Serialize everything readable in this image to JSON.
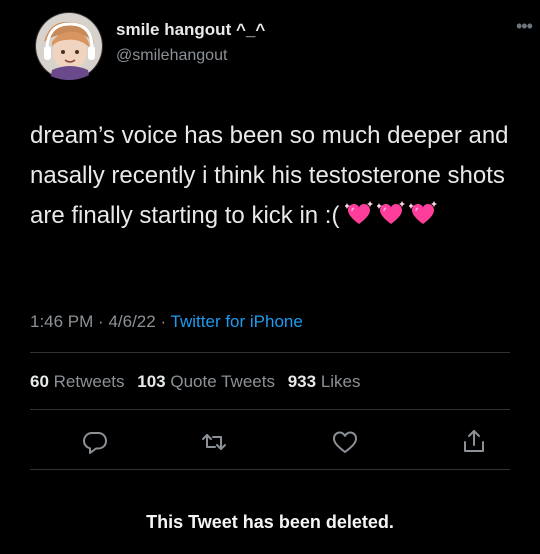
{
  "user": {
    "display_name": "smile hangout ^_^",
    "handle": "@smilehangout"
  },
  "tweet": {
    "text": "dream’s voice has been so much deeper and nasally recently i think his testosterone shots are finally starting to kick in :(",
    "emoji": [
      "sparkling-heart",
      "sparkling-heart",
      "sparkling-heart"
    ],
    "time": "1:46 PM",
    "date": "4/6/22",
    "separator": "·",
    "source": "Twitter for iPhone"
  },
  "stats": {
    "retweets_count": "60",
    "retweets_label": "Retweets",
    "quote_count": "103",
    "quote_label": "Quote Tweets",
    "likes_count": "933",
    "likes_label": "Likes"
  },
  "actions": [
    "reply-icon",
    "retweet-icon",
    "like-icon",
    "share-icon"
  ],
  "notice": "This Tweet has been deleted.",
  "colors": {
    "background": "#000000",
    "text": "#e7e9ea",
    "secondary": "#8b9196",
    "link": "#1d9bf0",
    "heart": "#ff3d9a"
  }
}
